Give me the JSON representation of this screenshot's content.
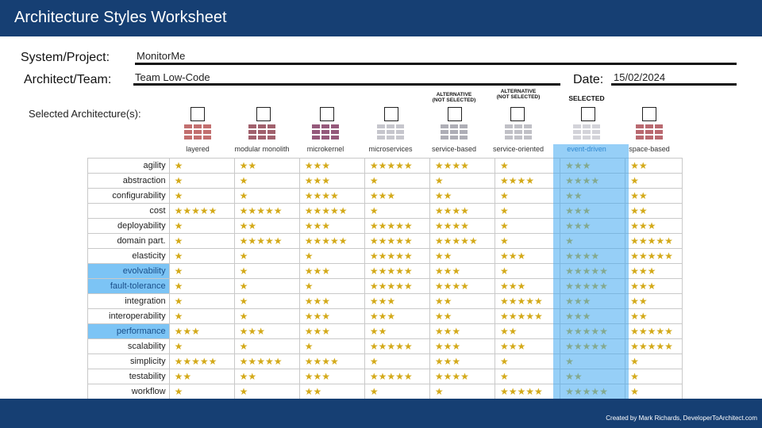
{
  "header": {
    "title": "Architecture Styles Worksheet"
  },
  "form": {
    "system_label": "System/Project:",
    "system_value": "MonitorMe",
    "architect_label": "Architect/Team:",
    "architect_value": "Team Low-Code",
    "date_label": "Date:",
    "date_value": "15/02/2024",
    "selected_label": "Selected Architecture(s):"
  },
  "columns": [
    {
      "name": "layered",
      "status": ""
    },
    {
      "name": "modular monolith",
      "status": ""
    },
    {
      "name": "microkernel",
      "status": ""
    },
    {
      "name": "microservices",
      "status": ""
    },
    {
      "name": "service-based",
      "status": "ALTERNATIVE\n(NOT SELECTED)"
    },
    {
      "name": "service-oriented",
      "status": "ALTERNATIVE\n(NOT SELECTED)"
    },
    {
      "name": "event-driven",
      "status": "SELECTED"
    },
    {
      "name": "space-based",
      "status": ""
    }
  ],
  "rows": [
    {
      "label": "agility",
      "highlight": false,
      "ratings": [
        1,
        2,
        3,
        5,
        4,
        1,
        3,
        2
      ]
    },
    {
      "label": "abstraction",
      "highlight": false,
      "ratings": [
        1,
        1,
        3,
        1,
        1,
        4,
        4,
        1
      ]
    },
    {
      "label": "configurability",
      "highlight": false,
      "ratings": [
        1,
        1,
        4,
        3,
        2,
        1,
        2,
        2
      ]
    },
    {
      "label": "cost",
      "highlight": false,
      "ratings": [
        5,
        5,
        5,
        1,
        4,
        1,
        3,
        2
      ]
    },
    {
      "label": "deployability",
      "highlight": false,
      "ratings": [
        1,
        2,
        3,
        5,
        4,
        1,
        3,
        3
      ]
    },
    {
      "label": "domain part.",
      "highlight": false,
      "ratings": [
        1,
        5,
        5,
        5,
        5,
        1,
        1,
        5
      ]
    },
    {
      "label": "elasticity",
      "highlight": false,
      "ratings": [
        1,
        1,
        1,
        5,
        2,
        3,
        4,
        5
      ]
    },
    {
      "label": "evolvability",
      "highlight": true,
      "ratings": [
        1,
        1,
        3,
        5,
        3,
        1,
        5,
        3
      ]
    },
    {
      "label": "fault-tolerance",
      "highlight": true,
      "ratings": [
        1,
        1,
        1,
        5,
        4,
        3,
        5,
        3
      ]
    },
    {
      "label": "integration",
      "highlight": false,
      "ratings": [
        1,
        1,
        3,
        3,
        2,
        5,
        3,
        2
      ]
    },
    {
      "label": "interoperability",
      "highlight": false,
      "ratings": [
        1,
        1,
        3,
        3,
        2,
        5,
        3,
        2
      ]
    },
    {
      "label": "performance",
      "highlight": true,
      "ratings": [
        3,
        3,
        3,
        2,
        3,
        2,
        5,
        5
      ]
    },
    {
      "label": "scalability",
      "highlight": false,
      "ratings": [
        1,
        1,
        1,
        5,
        3,
        3,
        5,
        5
      ]
    },
    {
      "label": "simplicity",
      "highlight": false,
      "ratings": [
        5,
        5,
        4,
        1,
        3,
        1,
        1,
        1
      ]
    },
    {
      "label": "testability",
      "highlight": false,
      "ratings": [
        2,
        2,
        3,
        5,
        4,
        1,
        2,
        1
      ]
    },
    {
      "label": "workflow",
      "highlight": false,
      "ratings": [
        1,
        1,
        2,
        1,
        1,
        5,
        5,
        1
      ]
    }
  ],
  "footer": {
    "credit": "Created by Mark Richards, DeveloperToArchitect.com"
  },
  "colors": {
    "brand": "#163f73",
    "selected_column": "#40a8f0",
    "star": "#d4aa1a",
    "highlight_row": "#7cc4f5"
  },
  "icons": {
    "star": "star-icon",
    "checkbox": "checkbox-icon"
  }
}
